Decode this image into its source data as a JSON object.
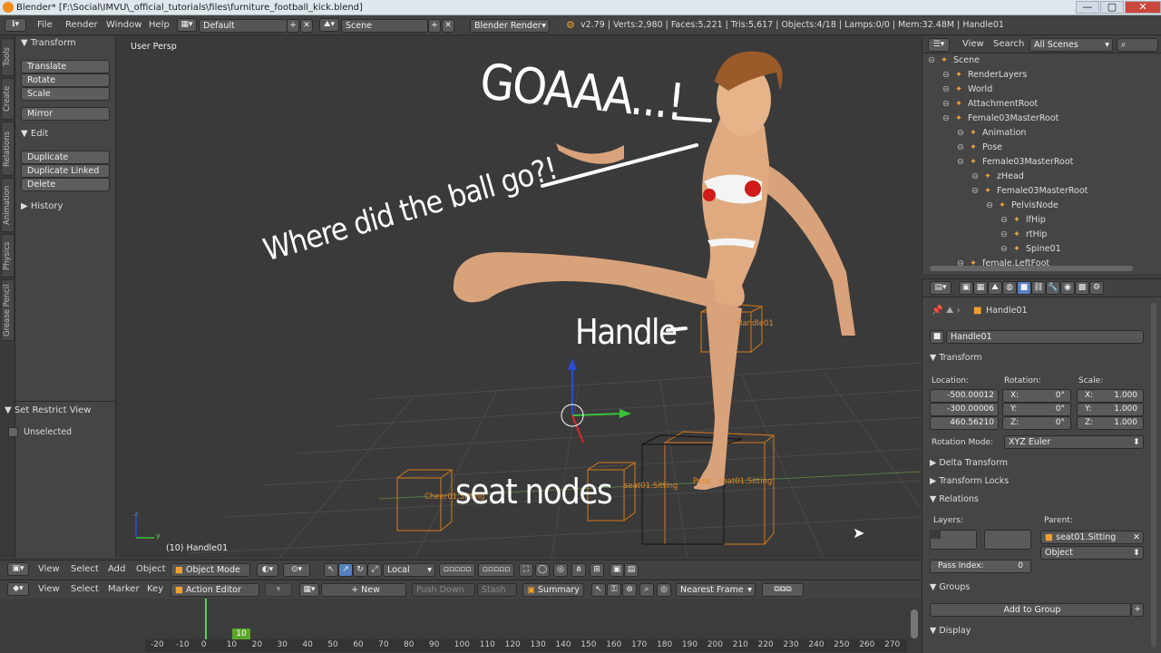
{
  "window": {
    "title": "Blender* [F:\\Social\\IMVU\\_official_tutorials\\files\\furniture_football_kick.blend]",
    "min": "—",
    "max": "▢",
    "close": "✕"
  },
  "menubar": {
    "items": [
      "File",
      "Render",
      "Window",
      "Help"
    ],
    "screen_layout": "Default",
    "scene": "Scene",
    "engine": "Blender Render",
    "stats": "v2.79 | Verts:2,980 | Faces:5,221 | Tris:5,617 | Objects:4/18 | Lamps:0/0 | Mem:32.48M | Handle01"
  },
  "sidebar_tabs": [
    "Tools",
    "Create",
    "Relations",
    "Animation",
    "Physics",
    "Grease Pencil"
  ],
  "tool_panel": {
    "transform_header": "Transform",
    "transform_buttons": [
      "Translate",
      "Rotate",
      "Scale"
    ],
    "mirror": "Mirror",
    "edit_header": "Edit",
    "edit_buttons": [
      "Duplicate",
      "Duplicate Linked",
      "Delete"
    ],
    "history_header": "History",
    "restrict_header": "Set Restrict View",
    "unselected": "Unselected"
  },
  "viewport": {
    "view_label": "User Persp",
    "status": "(10) Handle01",
    "annotation_goal": "GOAAA...!",
    "annotation_ball": "Where did the ball go?!",
    "annotation_handle": "Handle",
    "annotation_seat": "seat nodes",
    "handle_label": "Handle01",
    "seat_label_1": "seat01.Sitting",
    "seat_label_2": "seat01.Sitting",
    "seat_label_3": "Pose",
    "seat_label_4": "Cheer01.Sitting",
    "axis_z": "z",
    "axis_y": "y"
  },
  "view3d_header": {
    "items": [
      "View",
      "Select",
      "Add",
      "Object"
    ],
    "mode": "Object Mode",
    "orientation": "Local"
  },
  "dopesheet_header": {
    "items": [
      "View",
      "Select",
      "Marker",
      "Key"
    ],
    "editor": "Action Editor",
    "new": "New",
    "push_down": "Push Down",
    "stash": "Stash",
    "summary": "Summary",
    "snap": "Nearest Frame"
  },
  "timeline": {
    "current_frame": "10",
    "ticks": [
      "-20",
      "-10",
      "0",
      "10",
      "20",
      "30",
      "40",
      "50",
      "60",
      "70",
      "80",
      "90",
      "100",
      "110",
      "120",
      "130",
      "140",
      "150",
      "160",
      "170",
      "180",
      "190",
      "200",
      "210",
      "220",
      "230",
      "240",
      "250",
      "260",
      "270"
    ]
  },
  "outliner": {
    "menu_view": "View",
    "menu_search": "Search",
    "filter": "All Scenes",
    "tree": [
      {
        "label": "Scene",
        "indent": 0
      },
      {
        "label": "RenderLayers",
        "indent": 1
      },
      {
        "label": "World",
        "indent": 1
      },
      {
        "label": "AttachmentRoot",
        "indent": 1
      },
      {
        "label": "Female03MasterRoot",
        "indent": 1
      },
      {
        "label": "Animation",
        "indent": 2
      },
      {
        "label": "Pose",
        "indent": 2
      },
      {
        "label": "Female03MasterRoot",
        "indent": 2
      },
      {
        "label": "zHead",
        "indent": 3
      },
      {
        "label": "Female03MasterRoot",
        "indent": 3
      },
      {
        "label": "PelvisNode",
        "indent": 4
      },
      {
        "label": "lfHip",
        "indent": 5
      },
      {
        "label": "rtHip",
        "indent": 5
      },
      {
        "label": "Spine01",
        "indent": 5
      },
      {
        "label": "female.LeftFoot",
        "indent": 2
      }
    ]
  },
  "properties": {
    "breadcrumb": "Handle01",
    "object_name": "Handle01",
    "transform_header": "Transform",
    "location_label": "Location:",
    "rotation_label": "Rotation:",
    "scale_label": "Scale:",
    "location": [
      "-500.00012",
      "-300.00006",
      "460.56210"
    ],
    "rotation": [
      {
        "axis": "X:",
        "value": "0°"
      },
      {
        "axis": "Y:",
        "value": "0°"
      },
      {
        "axis": "Z:",
        "value": "0°"
      }
    ],
    "scale": [
      {
        "axis": "X:",
        "value": "1.000"
      },
      {
        "axis": "Y:",
        "value": "1.000"
      },
      {
        "axis": "Z:",
        "value": "1.000"
      }
    ],
    "rotation_mode_label": "Rotation Mode:",
    "rotation_mode": "XYZ Euler",
    "delta_transform": "Delta Transform",
    "transform_locks": "Transform Locks",
    "relations": "Relations",
    "layers_label": "Layers:",
    "parent_label": "Parent:",
    "parent": "seat01.Sitting",
    "parent_type": "Object",
    "pass_index_label": "Pass Index:",
    "pass_index": "0",
    "groups": "Groups",
    "add_to_group": "Add to Group",
    "display": "Display"
  }
}
